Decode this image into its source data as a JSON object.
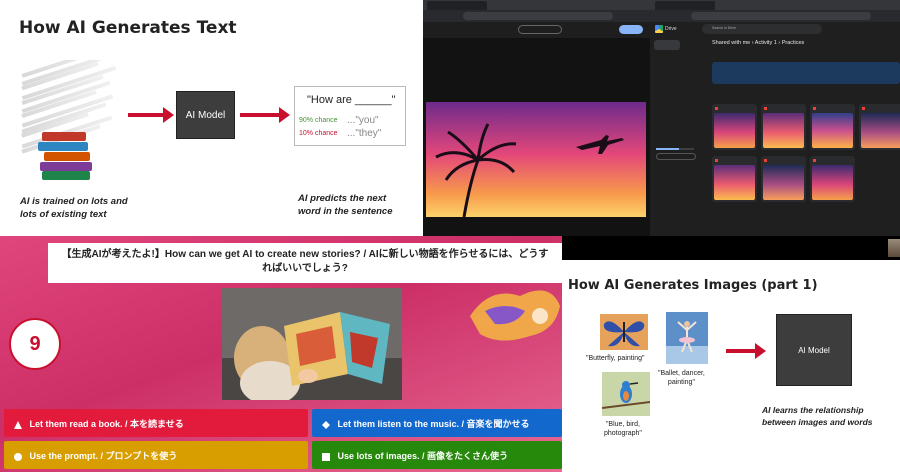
{
  "text_slide": {
    "title": "How AI Generates Text",
    "model_label": "AI Model",
    "prompt_text": "\"How are ______\"",
    "chance_1": "90% chance",
    "chance_2": "10% chance",
    "answer_1": "...\"you\"",
    "answer_2": "...\"they\"",
    "caption_left_1": "AI is trained on lots and",
    "caption_left_2": "lots of existing text",
    "caption_right_1": "AI predicts the next",
    "caption_right_2": "word in the sentence"
  },
  "quiz": {
    "question": "【生成AIが考えたよ!】How can we get AI to create new stories? / AIに新しい物語を作らせるには、どうすればいいでしょう?",
    "number": "9",
    "answers": [
      {
        "label": "Let them read a book. / 本を読ませる",
        "shape": "triangle"
      },
      {
        "label": "Let them listen to the music. / 音楽を聞かせる",
        "shape": "diamond"
      },
      {
        "label": "Use the prompt. / プロンプトを使う",
        "shape": "circle"
      },
      {
        "label": "Use lots of images. / 画像をたくさん使う",
        "shape": "square"
      }
    ],
    "colors": {
      "red": "#e21b3c",
      "blue": "#1368ce",
      "yellow": "#d89e00",
      "green": "#26890c"
    }
  },
  "image_slide": {
    "title": "How AI Generates Images (part 1)",
    "caption_1": "\"Butterfly, painting\"",
    "caption_2_line1": "\"Ballet, dancer,",
    "caption_2_line2": "painting\"",
    "caption_3_line1": "\"Blue, bird,",
    "caption_3_line2": "photograph\"",
    "model_label": "AI Model",
    "learn_line1": "AI learns the relationship",
    "learn_line2": "between images and words"
  },
  "drive": {
    "app_name": "Drive",
    "search_placeholder": "Search in Drive",
    "breadcrumb": "Shared with me  ›  Activity 1  ›  Practices"
  }
}
